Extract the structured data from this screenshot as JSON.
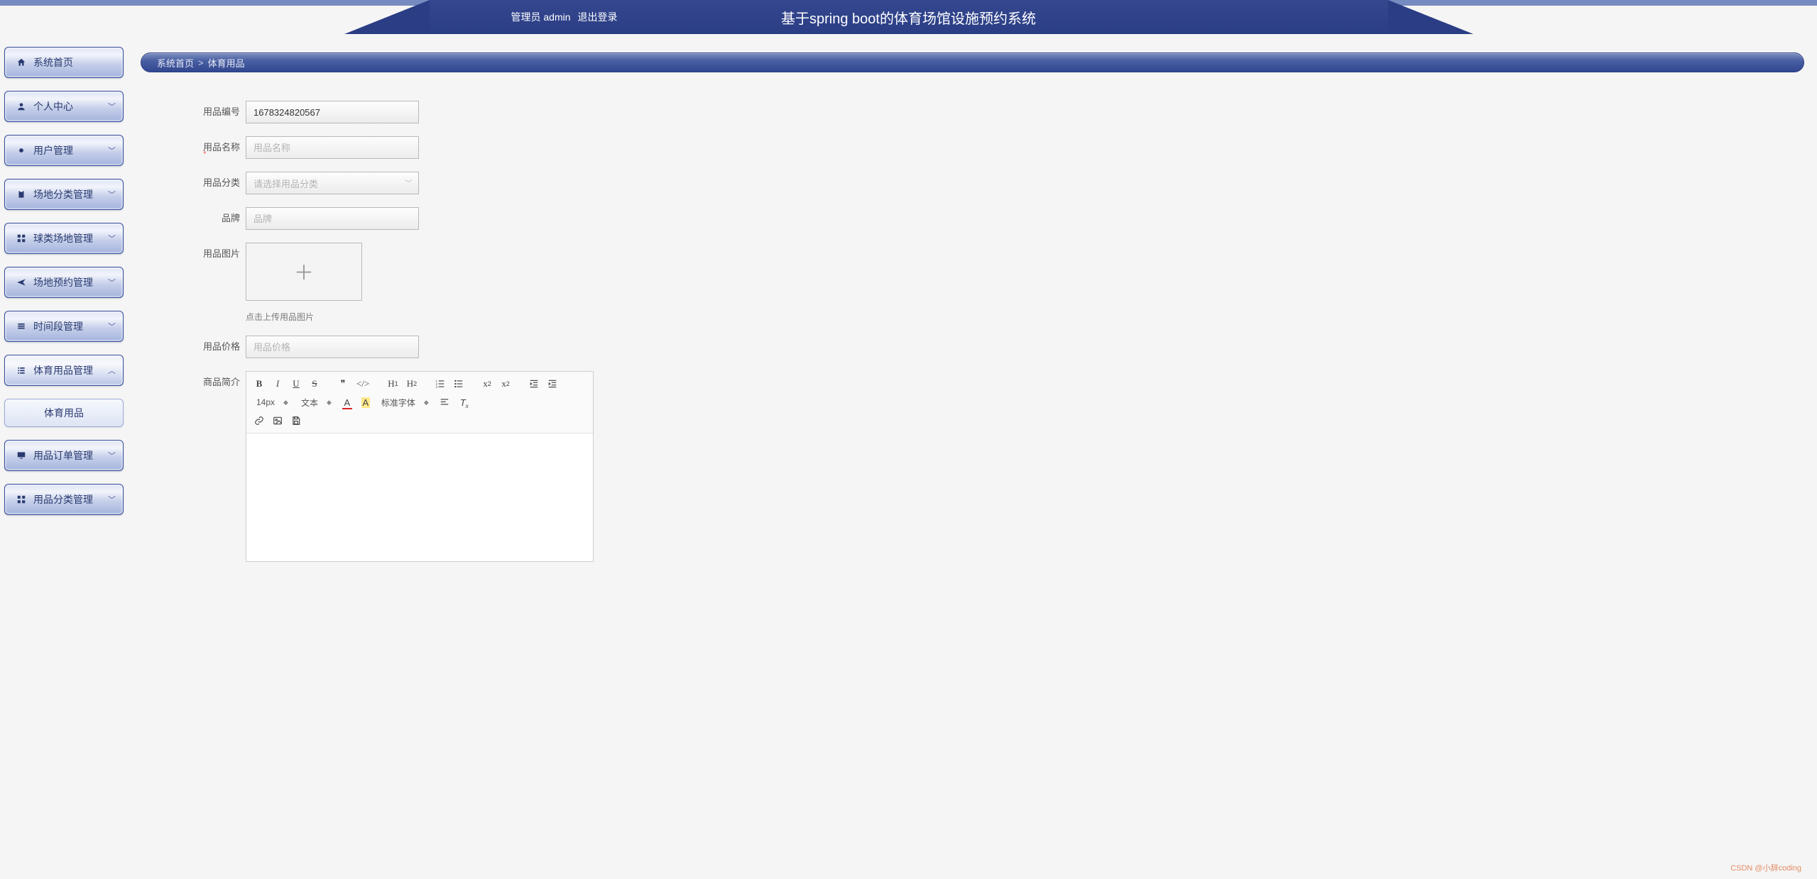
{
  "header": {
    "admin_label": "管理员 admin",
    "logout_label": "退出登录",
    "app_title": "基于spring boot的体育场馆设施预约系统"
  },
  "sidebar": {
    "items": [
      {
        "label": "系统首页",
        "icon": "home",
        "expandable": false
      },
      {
        "label": "个人中心",
        "icon": "user",
        "expandable": true,
        "open": false
      },
      {
        "label": "用户管理",
        "icon": "dot",
        "expandable": true,
        "open": false
      },
      {
        "label": "场地分类管理",
        "icon": "clipboard",
        "expandable": true,
        "open": false
      },
      {
        "label": "球类场地管理",
        "icon": "grid",
        "expandable": true,
        "open": false
      },
      {
        "label": "场地预约管理",
        "icon": "plane",
        "expandable": true,
        "open": false
      },
      {
        "label": "时间段管理",
        "icon": "stack",
        "expandable": true,
        "open": false
      },
      {
        "label": "体育用品管理",
        "icon": "list",
        "expandable": true,
        "open": true,
        "children": [
          {
            "label": "体育用品"
          }
        ]
      },
      {
        "label": "用品订单管理",
        "icon": "screen",
        "expandable": true,
        "open": false
      },
      {
        "label": "用品分类管理",
        "icon": "grid",
        "expandable": true,
        "open": false
      }
    ]
  },
  "breadcrumb": {
    "root": "系统首页",
    "sep": ">",
    "current": "体育用品"
  },
  "form": {
    "product_no": {
      "label": "用品编号",
      "value": "1678324820567"
    },
    "product_name": {
      "label": "用品名称",
      "placeholder": "用品名称"
    },
    "category": {
      "label": "用品分类",
      "placeholder": "请选择用品分类"
    },
    "brand": {
      "label": "品牌",
      "placeholder": "品牌"
    },
    "image": {
      "label": "用品图片",
      "hint": "点击上传用品图片"
    },
    "price": {
      "label": "用品价格",
      "placeholder": "用品价格"
    },
    "intro": {
      "label": "商品简介"
    }
  },
  "editor": {
    "font_size": "14px",
    "font_family": "文本",
    "font_default": "标准字体",
    "clear_fmt_title": "清除格式"
  },
  "watermark": "CSDN @小辞coding"
}
